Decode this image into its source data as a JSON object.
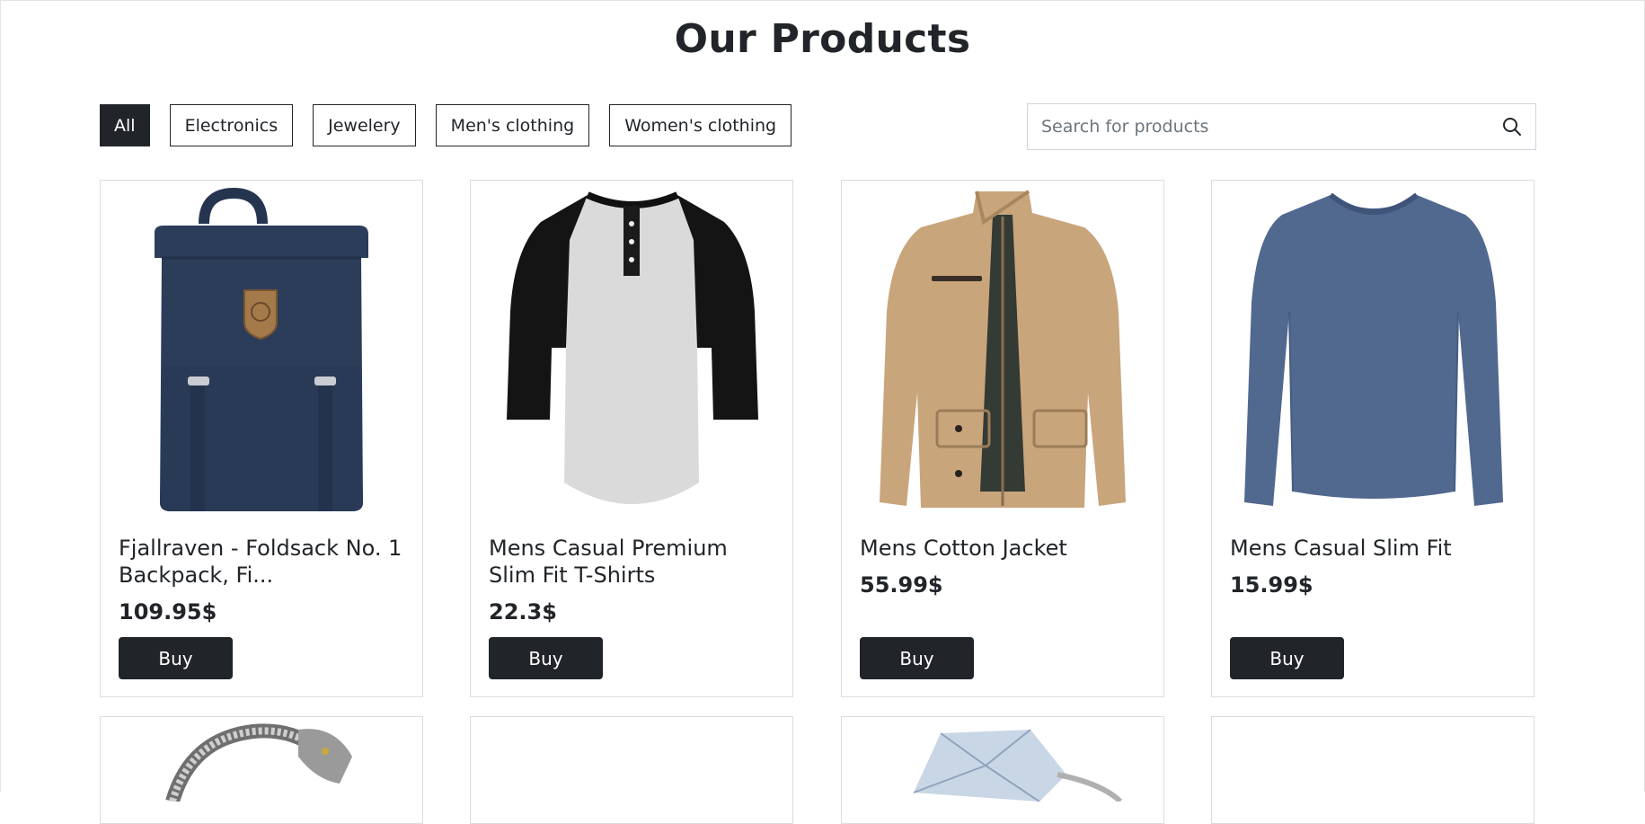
{
  "title": "Our Products",
  "filters": [
    "All",
    "Electronics",
    "Jewelery",
    "Men's clothing",
    "Women's clothing"
  ],
  "active_filter": "All",
  "search": {
    "placeholder": "Search for products",
    "value": "",
    "icon": "search-icon"
  },
  "products": [
    {
      "name": "Fjallraven - Foldsack No. 1 Backpack, Fi...",
      "price": "109.95$",
      "buy_label": "Buy",
      "image": "backpack"
    },
    {
      "name": "Mens Casual Premium Slim Fit T-Shirts",
      "price": "22.3$",
      "buy_label": "Buy",
      "image": "raglan-tshirt"
    },
    {
      "name": "Mens Cotton Jacket",
      "price": "55.99$",
      "buy_label": "Buy",
      "image": "cotton-jacket"
    },
    {
      "name": "Mens Casual Slim Fit",
      "price": "15.99$",
      "buy_label": "Buy",
      "image": "longsleeve-shirt"
    }
  ],
  "products_row2": [
    {
      "image": "dragon-bracelet"
    },
    {
      "image": ""
    },
    {
      "image": "diamond-ring"
    },
    {
      "image": ""
    }
  ],
  "colors": {
    "dark": "#212529",
    "border": "#dcdcdc"
  }
}
